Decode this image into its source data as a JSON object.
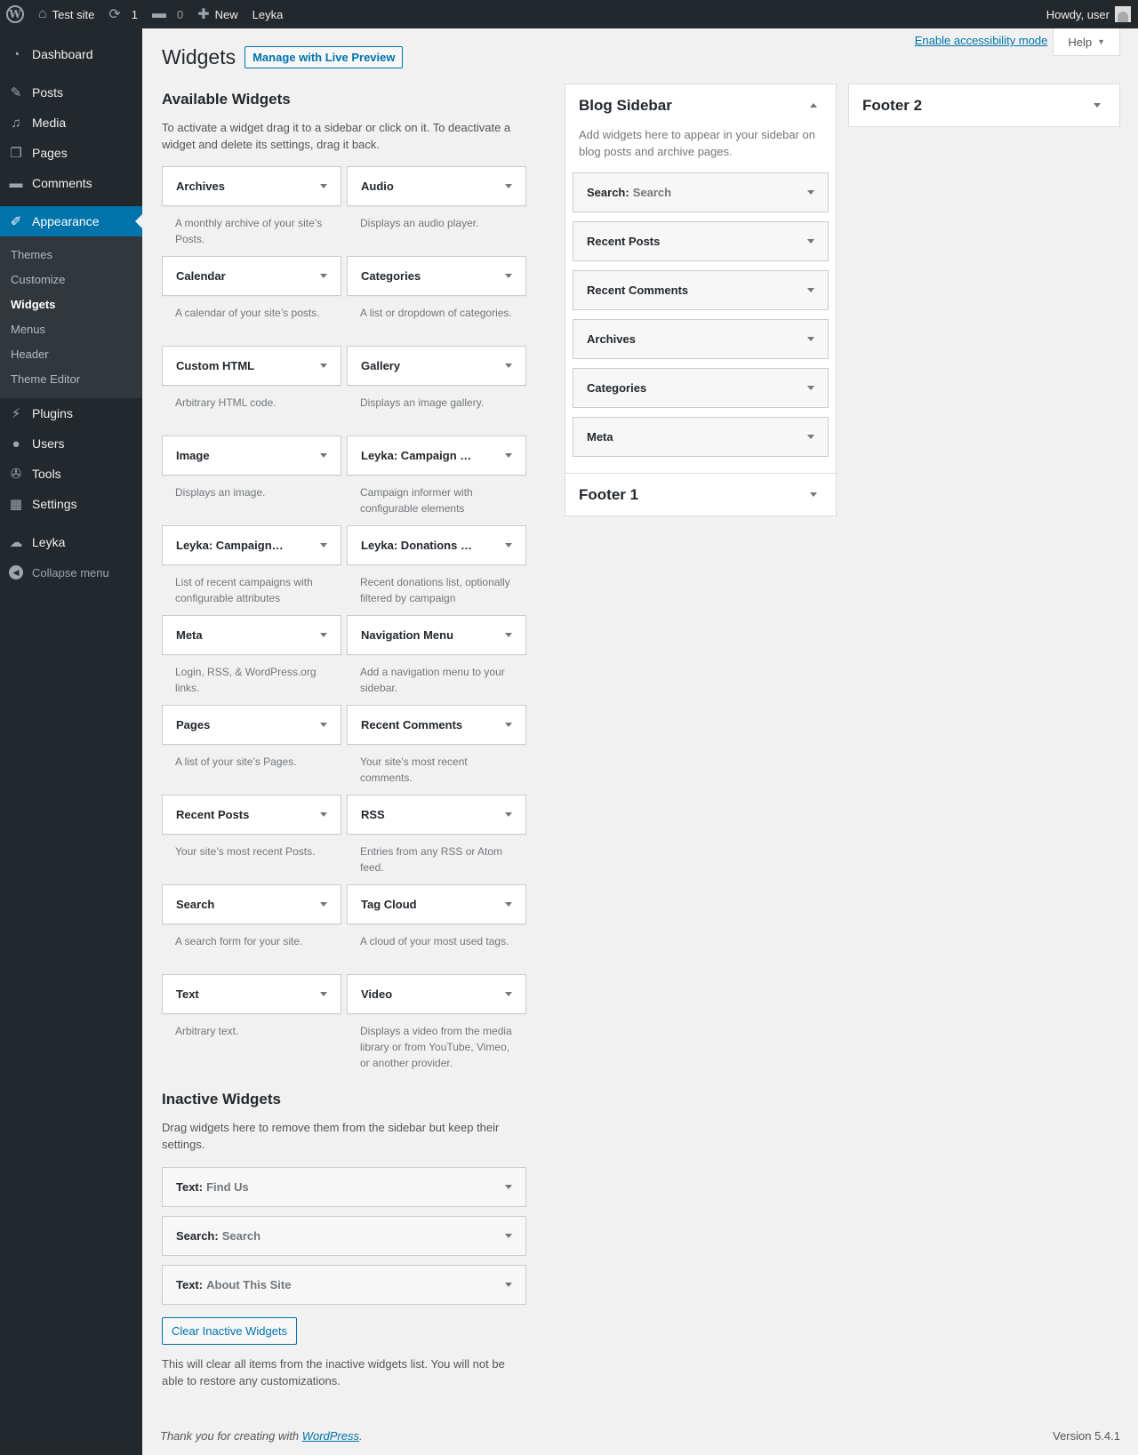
{
  "adminbar": {
    "site_name": "Test site",
    "updates_count": "1",
    "comments_count": "0",
    "new_label": "New",
    "leyka_label": "Leyka",
    "howdy": "Howdy, user"
  },
  "menu": {
    "dashboard": "Dashboard",
    "posts": "Posts",
    "media": "Media",
    "pages": "Pages",
    "comments": "Comments",
    "appearance": "Appearance",
    "appearance_sub": [
      "Themes",
      "Customize",
      "Widgets",
      "Menus",
      "Header",
      "Theme Editor"
    ],
    "plugins": "Plugins",
    "users": "Users",
    "tools": "Tools",
    "settings": "Settings",
    "leyka": "Leyka",
    "collapse": "Collapse menu"
  },
  "screen_meta": {
    "accessibility": "Enable accessibility mode",
    "help": "Help"
  },
  "page": {
    "title": "Widgets",
    "live_preview": "Manage with Live Preview"
  },
  "available": {
    "heading": "Available Widgets",
    "description": "To activate a widget drag it to a sidebar or click on it. To deactivate a widget and delete its settings, drag it back.",
    "widgets": [
      {
        "title": "Archives",
        "desc": "A monthly archive of your site’s Posts."
      },
      {
        "title": "Audio",
        "desc": "Displays an audio player."
      },
      {
        "title": "Calendar",
        "desc": "A calendar of your site’s posts."
      },
      {
        "title": "Categories",
        "desc": "A list or dropdown of categories."
      },
      {
        "title": "Custom HTML",
        "desc": "Arbitrary HTML code."
      },
      {
        "title": "Gallery",
        "desc": "Displays an image gallery."
      },
      {
        "title": "Image",
        "desc": "Displays an image."
      },
      {
        "title": "Leyka: Campaign …",
        "desc": "Campaign informer with configurable elements"
      },
      {
        "title": "Leyka: Campaign…",
        "desc": "List of recent campaigns with configurable attributes"
      },
      {
        "title": "Leyka: Donations …",
        "desc": "Recent donations list, optionally filtered by campaign"
      },
      {
        "title": "Meta",
        "desc": "Login, RSS, & WordPress.org links."
      },
      {
        "title": "Navigation Menu",
        "desc": "Add a navigation menu to your sidebar."
      },
      {
        "title": "Pages",
        "desc": "A list of your site’s Pages."
      },
      {
        "title": "Recent Comments",
        "desc": "Your site’s most recent comments."
      },
      {
        "title": "Recent Posts",
        "desc": "Your site’s most recent Posts."
      },
      {
        "title": "RSS",
        "desc": "Entries from any RSS or Atom feed."
      },
      {
        "title": "Search",
        "desc": "A search form for your site."
      },
      {
        "title": "Tag Cloud",
        "desc": "A cloud of your most used tags."
      },
      {
        "title": "Text",
        "desc": "Arbitrary text."
      },
      {
        "title": "Video",
        "desc": "Displays a video from the media library or from YouTube, Vimeo, or another provider."
      }
    ]
  },
  "inactive": {
    "heading": "Inactive Widgets",
    "description": "Drag widgets here to remove them from the sidebar but keep their settings.",
    "widgets": [
      {
        "label": "Text:",
        "sub": "Find Us"
      },
      {
        "label": "Search:",
        "sub": "Search"
      },
      {
        "label": "Text:",
        "sub": "About This Site"
      }
    ],
    "clear_button": "Clear Inactive Widgets",
    "clear_description": "This will clear all items from the inactive widgets list. You will not be able to restore any customizations."
  },
  "blog_sidebar": {
    "title": "Blog Sidebar",
    "description": "Add widgets here to appear in your sidebar on blog posts and archive pages.",
    "widgets": [
      {
        "label": "Search:",
        "sub": "Search"
      },
      {
        "label": "Recent Posts",
        "sub": ""
      },
      {
        "label": "Recent Comments",
        "sub": ""
      },
      {
        "label": "Archives",
        "sub": ""
      },
      {
        "label": "Categories",
        "sub": ""
      },
      {
        "label": "Meta",
        "sub": ""
      }
    ]
  },
  "footer1": {
    "title": "Footer 1"
  },
  "footer2": {
    "title": "Footer 2"
  },
  "footer": {
    "thanks_prefix": "Thank you for creating with ",
    "wordpress_link": "WordPress",
    "thanks_suffix": ".",
    "version": "Version 5.4.1"
  }
}
